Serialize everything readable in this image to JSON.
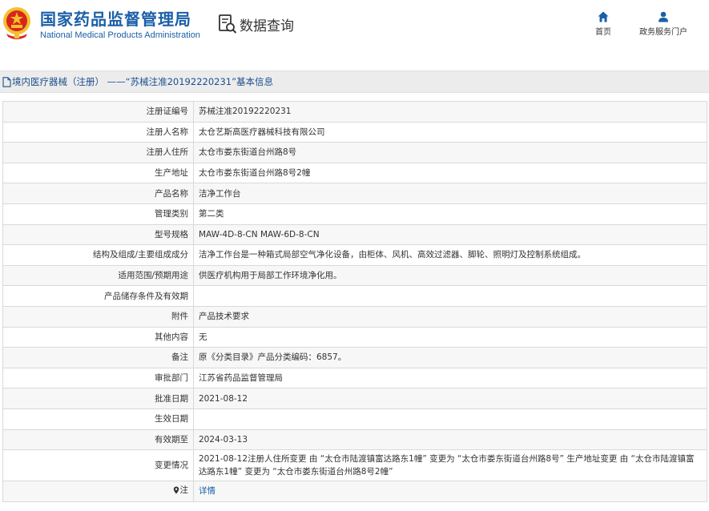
{
  "header": {
    "agency_cn": "国家药品监督管理局",
    "agency_en": "National Medical Products Administration",
    "site_title": "数据查询",
    "nav": {
      "home_label": "首页",
      "portal_label": "政务服务门户"
    }
  },
  "title_bar": {
    "text": "境内医疗器械（注册） ——“苏械注准20192220231”基本信息"
  },
  "details": [
    {
      "label": "注册证编号",
      "value": "苏械注准20192220231"
    },
    {
      "label": "注册人名称",
      "value": "太仓艺斯高医疗器械科技有限公司"
    },
    {
      "label": "注册人住所",
      "value": "太仓市娄东街道台州路8号"
    },
    {
      "label": "生产地址",
      "value": "太仓市娄东街道台州路8号2幢"
    },
    {
      "label": "产品名称",
      "value": "洁净工作台"
    },
    {
      "label": "管理类别",
      "value": "第二类"
    },
    {
      "label": "型号规格",
      "value": "MAW-4D-8-CN MAW-6D-8-CN"
    },
    {
      "label": "结构及组成/主要组成成分",
      "value": "洁净工作台是一种箱式局部空气净化设备，由柜体、风机、高效过滤器、脚轮、照明灯及控制系统组成。"
    },
    {
      "label": "适用范围/预期用途",
      "value": "供医疗机构用于局部工作环境净化用。"
    },
    {
      "label": "产品储存条件及有效期",
      "value": ""
    },
    {
      "label": "附件",
      "value": "产品技术要求"
    },
    {
      "label": "其他内容",
      "value": "无"
    },
    {
      "label": "备注",
      "value": "原《分类目录》产品分类编码：6857。"
    },
    {
      "label": "审批部门",
      "value": "江苏省药品监督管理局"
    },
    {
      "label": "批准日期",
      "value": "2021-08-12"
    },
    {
      "label": "生效日期",
      "value": ""
    },
    {
      "label": "有效期至",
      "value": "2024-03-13"
    },
    {
      "label": "变更情况",
      "value": "2021-08-12注册人住所变更 由 “太仓市陆渡镇富达路东1幢” 变更为 “太仓市娄东街道台州路8号” 生产地址变更 由 “太仓市陆渡镇富达路东1幢” 变更为 “太仓市娄东街道台州路8号2幢”"
    }
  ],
  "note": {
    "label": "注",
    "link_text": "详情"
  },
  "colors": {
    "brand_blue": "#1a5fa8",
    "title_bar_bg": "#ececec",
    "emblem_red": "#d9261c",
    "emblem_gold": "#f2c12e"
  }
}
